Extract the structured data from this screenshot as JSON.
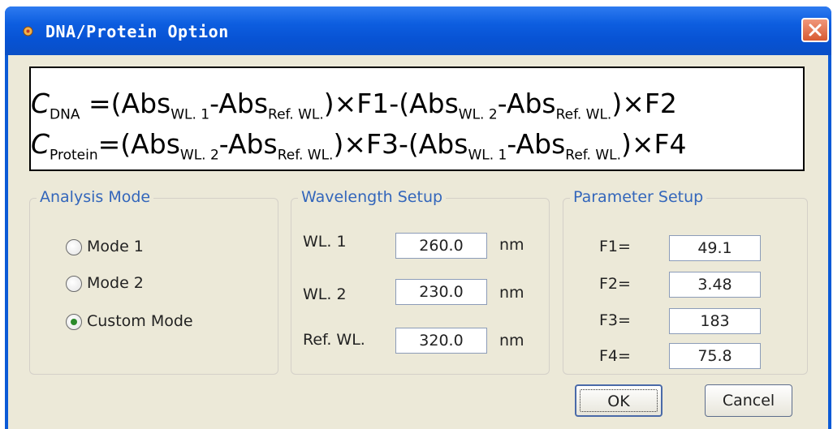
{
  "window": {
    "title": "DNA/Protein Option"
  },
  "formula": {
    "line1": {
      "c": "C",
      "c_sub": "DNA",
      "p1": " =(Abs",
      "s1": "WL. 1",
      "p2": "-Abs",
      "s2": "Ref. WL.",
      "p3": ")×F1-(Abs",
      "s3": "WL. 2",
      "p4": "-Abs",
      "s4": "Ref. WL.",
      "p5": ")×F2"
    },
    "line2": {
      "c": "C",
      "c_sub": "Protein",
      "p1": "=(Abs",
      "s1": "WL. 2",
      "p2": "-Abs",
      "s2": "Ref. WL.",
      "p3": ")×F3-(Abs",
      "s3": "WL. 1",
      "p4": "-Abs",
      "s4": "Ref. WL.",
      "p5": ")×F4"
    }
  },
  "analysis_mode": {
    "legend": "Analysis Mode",
    "options": [
      {
        "label": "Mode 1",
        "selected": false
      },
      {
        "label": "Mode 2",
        "selected": false
      },
      {
        "label": "Custom Mode",
        "selected": true
      }
    ]
  },
  "wavelength": {
    "legend": "Wavelength Setup",
    "rows": [
      {
        "label": "WL. 1",
        "value": "260.0",
        "unit": "nm"
      },
      {
        "label": "WL. 2",
        "value": "230.0",
        "unit": "nm"
      },
      {
        "label": "Ref. WL.",
        "value": "320.0",
        "unit": "nm"
      }
    ]
  },
  "parameters": {
    "legend": "Parameter Setup",
    "rows": [
      {
        "label": "F1=",
        "value": "49.1"
      },
      {
        "label": "F2=",
        "value": "3.48"
      },
      {
        "label": "F3=",
        "value": "183"
      },
      {
        "label": "F4=",
        "value": "75.8"
      }
    ]
  },
  "buttons": {
    "ok": "OK",
    "cancel": "Cancel"
  },
  "colors": {
    "titlebar": "#0752d3",
    "dialog_bg": "#ece9d8",
    "group_legend": "#3366bb",
    "close": "#d85a31",
    "radio_dot": "#2b8a2b"
  }
}
